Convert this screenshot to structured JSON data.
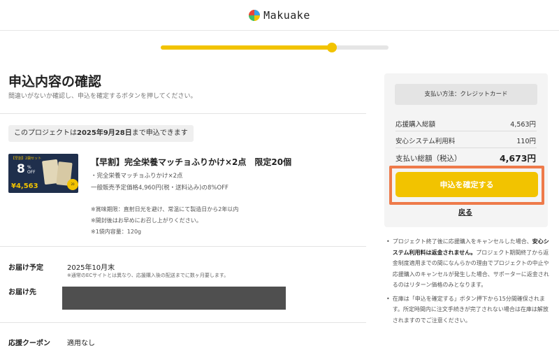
{
  "header": {
    "brand": "Makuake"
  },
  "progress": {
    "fraction": 0.75
  },
  "page": {
    "title": "申込内容の確認",
    "subtitle": "間違いがないか確認し、申込を確定するボタンを押してください。"
  },
  "deadline": {
    "prefix": "このプロジェクトは",
    "date": "2025年9月28日",
    "suffix": "まで申込できます"
  },
  "item": {
    "thumbnail": {
      "badge": "【早割】2袋セット",
      "percent": "8",
      "percent_unit": "%",
      "off": "OFF",
      "price": "¥4,563",
      "sticker": "20"
    },
    "title": "【早割】完全栄養マッチョふりかけ×2点　限定20個",
    "line1": "・完全栄養マッチョふりかけ×2点",
    "line2": "一般販売予定価格4,960円(税・送料込み)の8%OFF",
    "notes": [
      "※賞味期限：直射日光を避け、常温にて製造日から2年以内",
      "※開封後はお早めにお召し上がりください。",
      "※1袋内容量：120g"
    ]
  },
  "delivery": {
    "label": "お届け予定",
    "value": "2025年10月末",
    "note": "※通常のECサイトとは異なり、応援購入後の配送までに数ヶ月要します。",
    "address_label": "お届け先"
  },
  "coupon": {
    "label": "応援クーポン",
    "value": "適用なし"
  },
  "summary": {
    "payment_method": "支払い方法：クレジットカード",
    "rows": [
      {
        "label": "応援購入総額",
        "value": "4,563円"
      },
      {
        "label": "安心システム利用料",
        "value": "110円"
      }
    ],
    "total_label": "支払い総額（税込）",
    "total_value": "4,673円",
    "confirm_label": "申込を確定する",
    "back_label": "戻る"
  },
  "notes": {
    "n1_a": "プロジェクト終了後に応援購入をキャンセルした場合、",
    "n1_b": "安心システム利用料は返金されません。",
    "n1_c": "プロジェクト期間終了から返金制度適用までの間になんらかの理由でプロジェクトの中止や応援購入のキャンセルが発生した場合、サポーターに返金されるのはリターン価格のみとなります。",
    "n2": "在庫は「申込を確定する」ボタン押下から15分間確保されます。所定時間内に注文手続きが完了されない場合は在庫は解放されますのでご注意ください。"
  },
  "colors": {
    "accent": "#f2c300",
    "highlight": "#ee7a4a"
  }
}
